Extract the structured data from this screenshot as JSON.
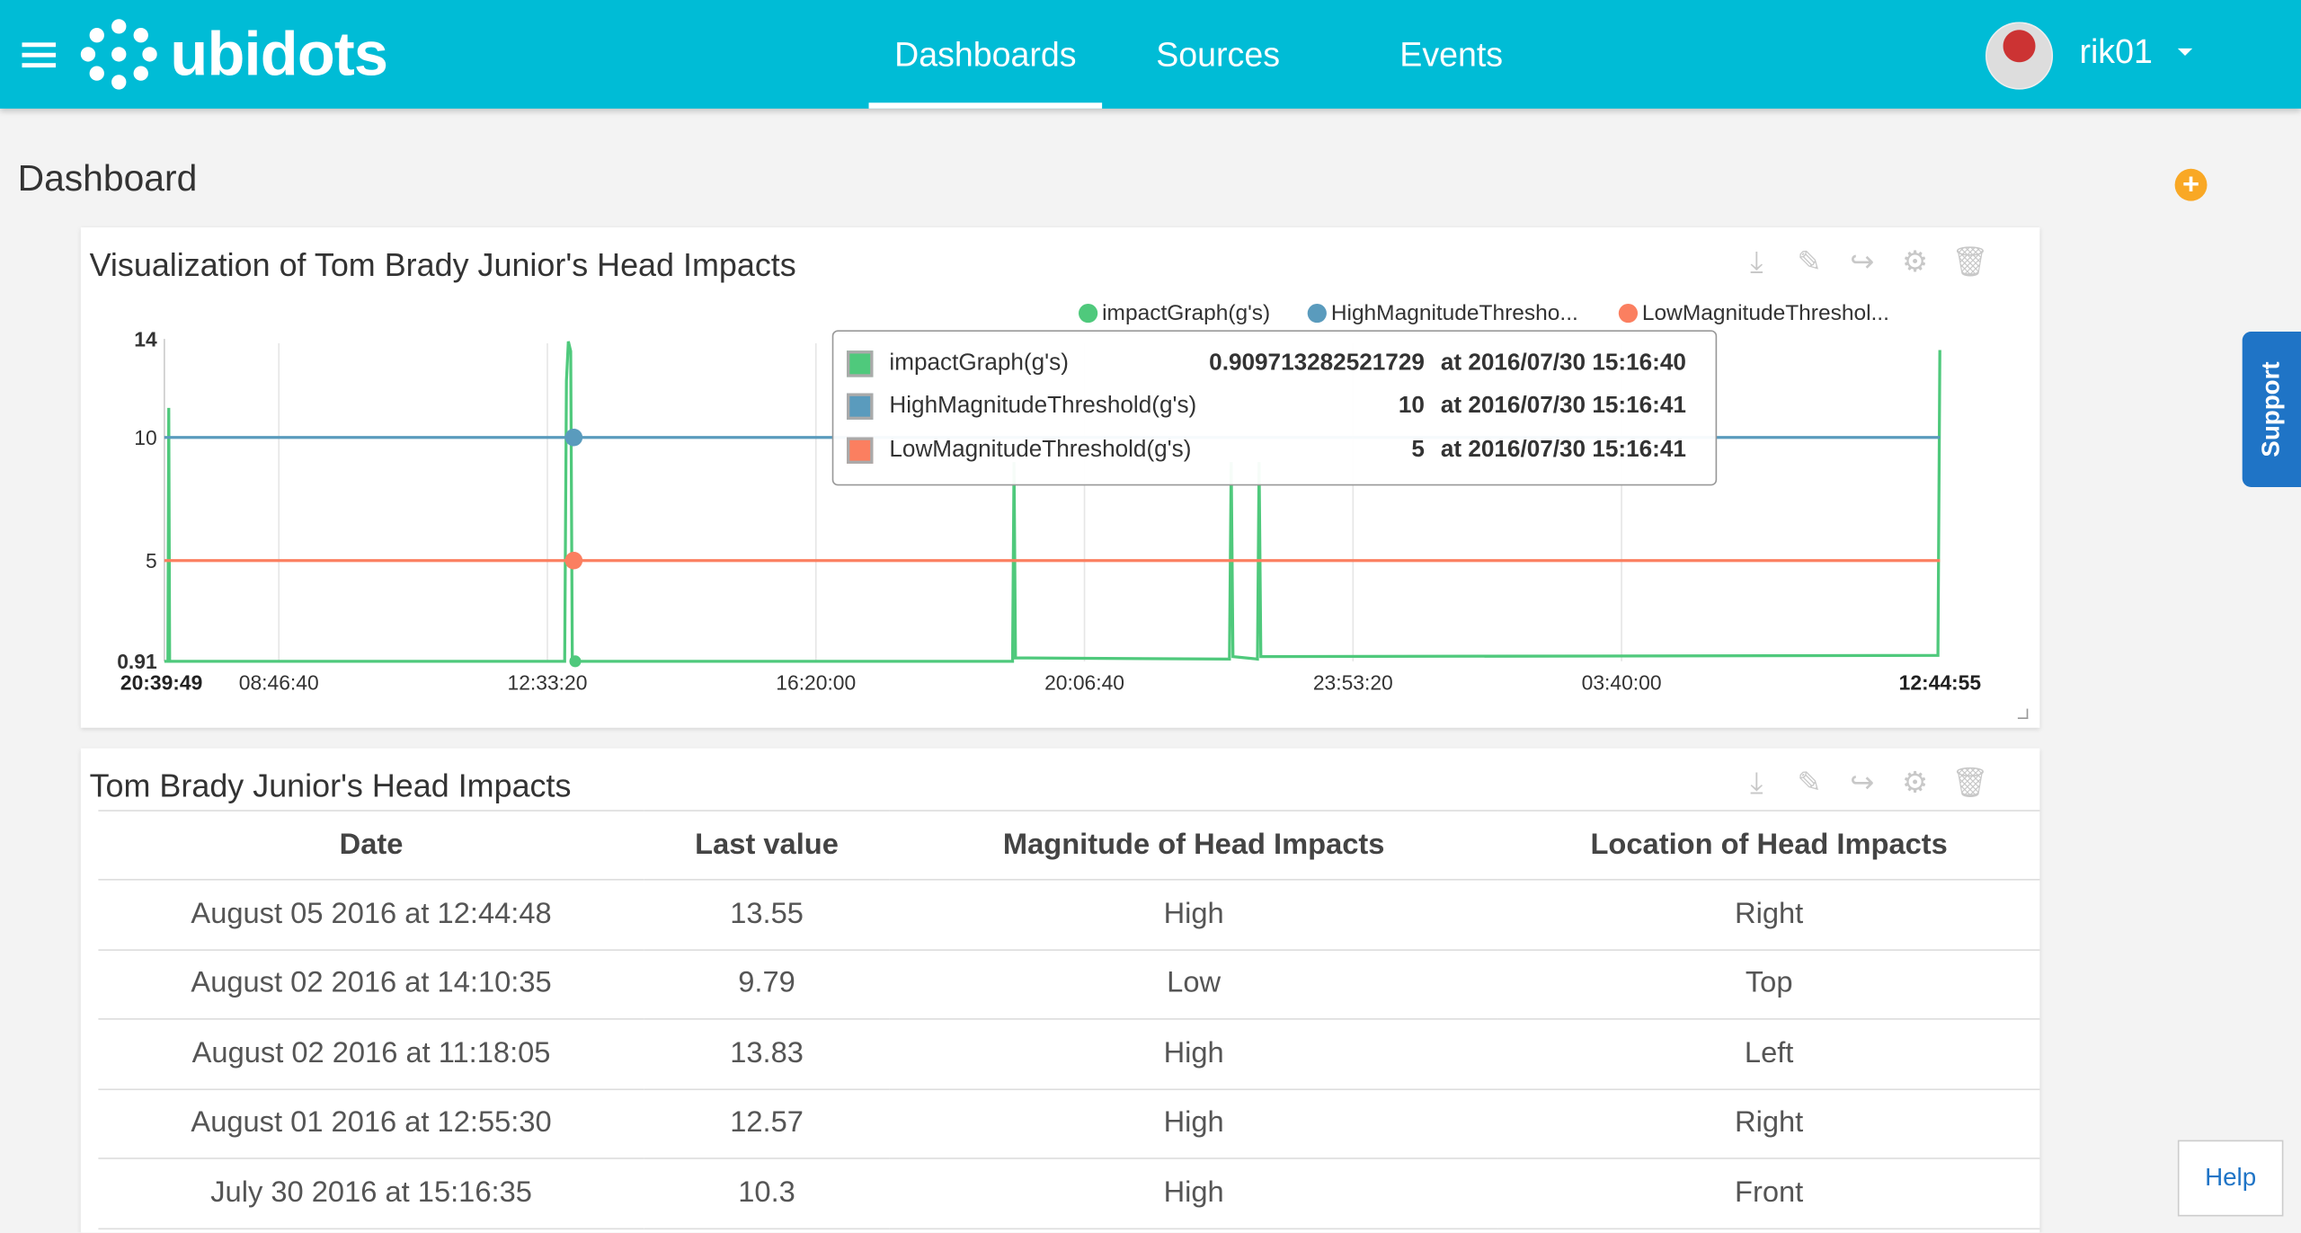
{
  "header": {
    "logo_text": "ubidots",
    "nav": [
      {
        "label": "Dashboards",
        "active": true
      },
      {
        "label": "Sources"
      },
      {
        "label": "Events"
      }
    ],
    "user": "rik01",
    "brand_color": "#00bcd6"
  },
  "page": {
    "title": "Dashboard",
    "add_icon": "plus-circle-icon"
  },
  "chart_widget": {
    "title": "Visualization of Tom Brady Junior's Head Impacts",
    "tools": [
      "download-icon",
      "pencil-icon",
      "share-icon",
      "gear-icon",
      "trash-icon"
    ],
    "legend": [
      {
        "label": "impactGraph(g's)",
        "color": "#4fc97c"
      },
      {
        "label": "HighMagnitudeThresho...",
        "color": "#5a9bbd"
      },
      {
        "label": "LowMagnitudeThreshol...",
        "color": "#fb7f60"
      }
    ],
    "tooltip": [
      {
        "name": "impactGraph(g's)",
        "value": "0.909713282521729",
        "at": "at 2016/07/30 15:16:40",
        "color": "#4fc97c"
      },
      {
        "name": "HighMagnitudeThreshold(g's)",
        "value": "10",
        "at": "at 2016/07/30 15:16:41",
        "color": "#5a9bbd"
      },
      {
        "name": "LowMagnitudeThreshold(g's)",
        "value": "5",
        "at": "at 2016/07/30 15:16:41",
        "color": "#fb7f60"
      }
    ]
  },
  "chart_data": {
    "type": "line",
    "ylim": [
      0.91,
      14
    ],
    "yticks": [
      "14",
      "10",
      "5",
      "0.91"
    ],
    "xtick_start": "20:39:49",
    "xticks": [
      "08:46:40",
      "12:33:20",
      "16:20:00",
      "20:06:40",
      "23:53:20",
      "03:40:00"
    ],
    "xtick_end": "12:44:55",
    "grid": "vertical",
    "legend_position": "top-right",
    "series": [
      {
        "name": "impactGraph(g's)",
        "color": "#4fc97c",
        "points": [
          [
            "07:10:03",
            0.91
          ],
          [
            "07:13:00",
            0.91
          ],
          [
            "07:13:46",
            11.2
          ],
          [
            "07:14:30",
            0.91
          ],
          [
            "12:48:00",
            0.91
          ],
          [
            "12:49:26",
            12.3
          ],
          [
            "12:51:00",
            13.9
          ],
          [
            "12:53:00",
            13.5
          ],
          [
            "12:54:24",
            0.91
          ],
          [
            "19:06:00",
            0.91
          ],
          [
            "19:07:14",
            9.0
          ],
          [
            "19:08:30",
            1.05
          ],
          [
            "22:09:00",
            1.0
          ],
          [
            "22:10:33",
            9.0
          ],
          [
            "22:12:00",
            1.1
          ],
          [
            "22:32:40",
            1.0
          ],
          [
            "22:34:05",
            9.0
          ],
          [
            "22:35:30",
            1.1
          ],
          [
            "08:07:00",
            1.15
          ],
          [
            "08:08:43",
            13.55
          ]
        ]
      },
      {
        "name": "HighMagnitudeThreshold(g's)",
        "color": "#5a9bbd",
        "constant": 10
      },
      {
        "name": "LowMagnitudeThreshold(g's)",
        "color": "#fb7f60",
        "constant": 5
      }
    ]
  },
  "table_widget": {
    "title": "Tom Brady Junior's Head Impacts",
    "tools": [
      "download-icon",
      "pencil-icon",
      "share-icon",
      "gear-icon",
      "trash-icon"
    ],
    "columns": [
      "Date",
      "Last value",
      "Magnitude of Head Impacts",
      "Location of Head Impacts"
    ],
    "rows": [
      [
        "August 05 2016 at 12:44:48",
        "13.55",
        "High",
        "Right"
      ],
      [
        "August 02 2016 at 14:10:35",
        "9.79",
        "Low",
        "Top"
      ],
      [
        "August 02 2016 at 11:18:05",
        "13.83",
        "High",
        "Left"
      ],
      [
        "August 01 2016 at 12:55:30",
        "12.57",
        "High",
        "Right"
      ],
      [
        "July 30 2016 at 15:16:35",
        "10.3",
        "High",
        "Front"
      ]
    ]
  },
  "support_label": "Support",
  "help_label": "Help"
}
